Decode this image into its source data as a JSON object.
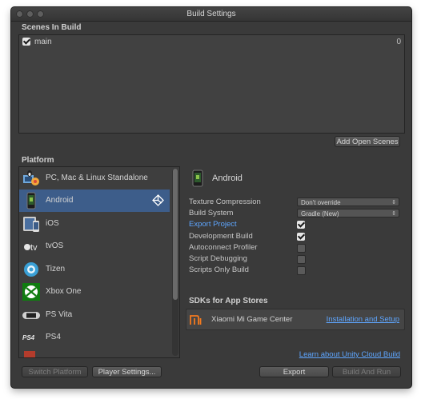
{
  "window": {
    "title": "Build Settings"
  },
  "scenes": {
    "header": "Scenes In Build",
    "items": [
      {
        "name": "main",
        "index": "0",
        "checked": true
      }
    ],
    "add_open_scenes": "Add Open Scenes"
  },
  "platform": {
    "header": "Platform",
    "items": [
      {
        "label": "PC, Mac & Linux Standalone",
        "icon": "unity-standalone-icon"
      },
      {
        "label": "Android",
        "icon": "android-phone-icon",
        "selected": true
      },
      {
        "label": "iOS",
        "icon": "ios-device-icon"
      },
      {
        "label": "tvOS",
        "icon": "appletv-icon"
      },
      {
        "label": "Tizen",
        "icon": "tizen-icon"
      },
      {
        "label": "Xbox One",
        "icon": "xbox-icon"
      },
      {
        "label": "PS Vita",
        "icon": "ps-vita-icon"
      },
      {
        "label": "PS4",
        "icon": "ps4-icon"
      }
    ],
    "current_platform_icon": "unity-logo-icon"
  },
  "settings": {
    "platform_title": "Android",
    "texture_compression": {
      "label": "Texture Compression",
      "value": "Don't override"
    },
    "build_system": {
      "label": "Build System",
      "value": "Gradle (New)"
    },
    "export_project": {
      "label": "Export Project",
      "checked": true
    },
    "development_build": {
      "label": "Development Build",
      "checked": true
    },
    "autoconnect_profiler": {
      "label": "Autoconnect Profiler",
      "checked": false
    },
    "script_debugging": {
      "label": "Script Debugging",
      "checked": false
    },
    "scripts_only_build": {
      "label": "Scripts Only Build",
      "checked": false
    }
  },
  "sdks": {
    "header": "SDKs for App Stores",
    "items": [
      {
        "name": "Xiaomi Mi Game Center",
        "link": "Installation and Setup",
        "icon": "mi-logo-icon"
      }
    ]
  },
  "cloud_build_link": "Learn about Unity Cloud Build",
  "buttons": {
    "switch_platform": "Switch Platform",
    "player_settings": "Player Settings...",
    "export": "Export",
    "build_and_run": "Build And Run"
  },
  "colors": {
    "selection": "#3d5d8a",
    "link": "#5ea6ff",
    "window_bg": "#3a3a3a"
  }
}
